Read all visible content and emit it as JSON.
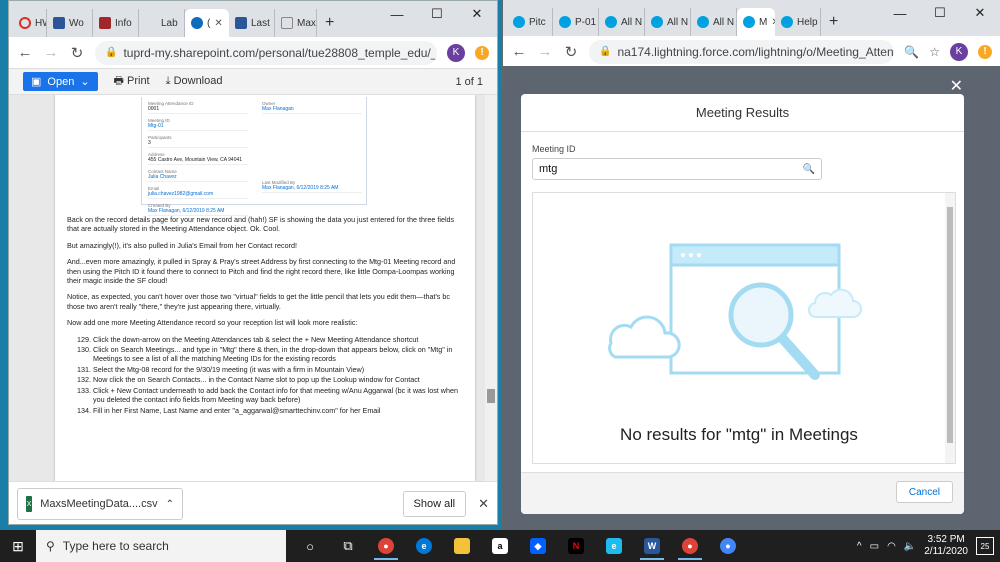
{
  "left_browser": {
    "tabs": [
      {
        "label": "HW",
        "color": "#d93025"
      },
      {
        "label": "Wo",
        "color": "#2b579a"
      },
      {
        "label": "Info",
        "color": "#a0282a"
      },
      {
        "label": "Lab",
        "color": "#ffffff"
      },
      {
        "label": "(",
        "color": "#0f6cbd",
        "active": true
      },
      {
        "label": "Last",
        "color": "#2b579a"
      },
      {
        "label": "Max",
        "color": "#ffffff"
      }
    ],
    "url": "tuprd-my.sharepoint.com/personal/tue28808_temple_edu/_layo...",
    "profile_initial": "K"
  },
  "pdf": {
    "open_label": "Open",
    "print_label": "Print",
    "download_label": "Download",
    "page_count": "1 of 1"
  },
  "record_card": {
    "left": [
      {
        "label": "Meeting Attendance ID",
        "value": "0001"
      },
      {
        "label": "Meeting ID",
        "value": "Mtg-01",
        "link": true
      },
      {
        "label": "Participants",
        "value": "3"
      },
      {
        "label": "Address",
        "value": "455 Castro Ave, Mountain View, CA 94041"
      },
      {
        "label": "Contact Name",
        "value": "Julia Chavez",
        "link": true
      },
      {
        "label": "Email",
        "value": "julia.chavez1982@gmail.com",
        "link": true
      },
      {
        "label": "Created By",
        "value": "Max Flanagan, 6/12/2019 8:25 AM",
        "link": true
      }
    ],
    "right": [
      {
        "label": "Owner",
        "value": "Max Flanagan",
        "link": true
      },
      {
        "label": "Last Modified By",
        "value": "Max Flanagan, 6/12/2019 8:25 AM",
        "link": true
      }
    ]
  },
  "doc": {
    "p1": "Back on the record details page for your new record and (hah!) SF is showing the data you just entered for the three fields that are actually stored in the Meeting Attendance object. Ok. Cool.",
    "p2": "But amazingly(!), it's also pulled in Julia's Email from her Contact record!",
    "p3": "And...even more amazingly, it pulled in Spray & Pray's street Address by first connecting to the Mtg-01 Meeting record and then using the Pitch ID it found there to connect to Pitch and find the right record there, like little Oompa-Loompas working their magic inside the SF cloud!",
    "p4": "Notice, as expected, you can't hover over those two \"virtual\" fields to get the little pencil that lets you edit them—that's bc those two aren't really \"there,\" they're just appearing there, virtually.",
    "p5": "Now add one more Meeting Attendance record so your reception list will look more realistic:",
    "steps": [
      {
        "n": "129.",
        "text": "Click the down-arrow on the Meeting Attendances tab & select the + New Meeting Attendance shortcut"
      },
      {
        "n": "130.",
        "text": "Click on Search Meetings... and type in \"Mtg\" there & then, in the drop-down that appears below, click on \"Mtg\" in Meetings to see a list of all the matching Meeting IDs for the existing records"
      },
      {
        "n": "131.",
        "text": "Select the Mtg-08 record for the 9/30/19 meeting (it was with a firm in Mountain View)"
      },
      {
        "n": "132.",
        "text": "Now click the on Search Contacts... in the Contact Name slot to pop up the Lookup window for Contact"
      },
      {
        "n": "133.",
        "text": "Click + New Contact underneath to add back the Contact info for that meeting w/Anu Aggarwal (bc it was lost when you deleted the contact info fields from Meeting way back before)"
      },
      {
        "n": "134.",
        "text": "Fill in her First Name, Last Name and enter \"a_aggarwal@smarttechinv.com\" for her Email"
      }
    ]
  },
  "download_bar": {
    "file_name": "MaxsMeetingData....csv",
    "show_all_label": "Show all"
  },
  "right_browser": {
    "tabs": [
      {
        "label": "Pitc",
        "color": "#00a1e0"
      },
      {
        "label": "P-01",
        "color": "#00a1e0"
      },
      {
        "label": "All N",
        "color": "#00a1e0"
      },
      {
        "label": "All N",
        "color": "#00a1e0"
      },
      {
        "label": "All N",
        "color": "#00a1e0"
      },
      {
        "label": "M",
        "color": "#00a1e0",
        "active": true
      },
      {
        "label": "Help",
        "color": "#00a1e0"
      }
    ],
    "url": "na174.lightning.force.com/lightning/o/Meeting_Attendance..."
  },
  "modal": {
    "title": "Meeting Results",
    "field_label": "Meeting ID",
    "search_value": "mtg",
    "empty_message": "No results for \"mtg\" in Meetings",
    "cancel_label": "Cancel"
  },
  "taskbar": {
    "search_placeholder": "Type here to search",
    "time": "3:52 PM",
    "date": "2/11/2020",
    "notification_count": "25"
  }
}
